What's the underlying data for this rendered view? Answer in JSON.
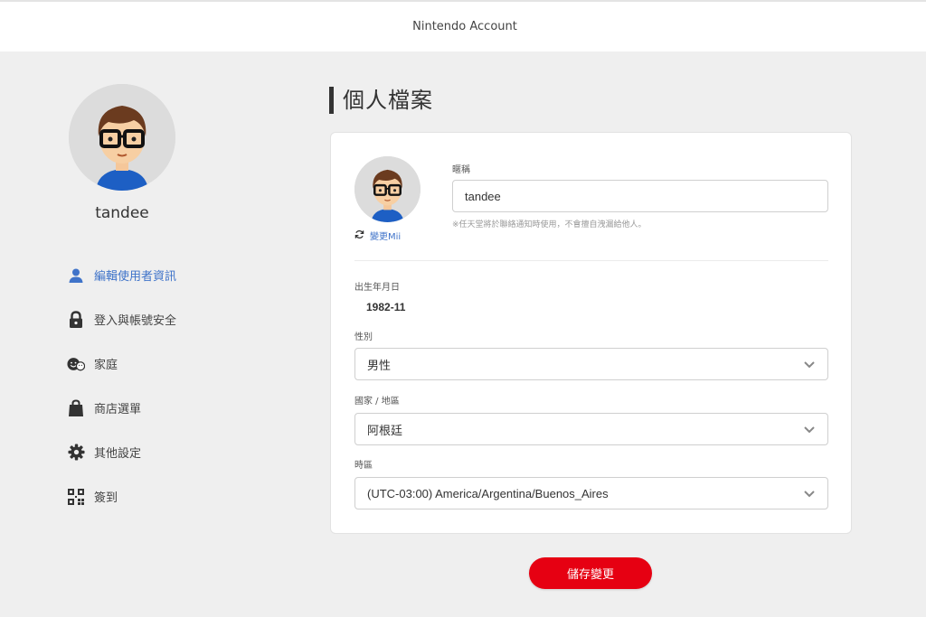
{
  "header": {
    "title": "Nintendo Account"
  },
  "sidebar": {
    "username": "tandee",
    "items": [
      {
        "label": "編輯使用者資訊",
        "icon": "user-icon",
        "active": true
      },
      {
        "label": "登入與帳號安全",
        "icon": "lock-icon",
        "active": false
      },
      {
        "label": "家庭",
        "icon": "family-icon",
        "active": false
      },
      {
        "label": "商店選單",
        "icon": "shopping-bag-icon",
        "active": false
      },
      {
        "label": "其他設定",
        "icon": "gear-icon",
        "active": false
      },
      {
        "label": "簽到",
        "icon": "qr-code-icon",
        "active": false
      }
    ]
  },
  "main": {
    "title": "個人檔案",
    "change_mii": "變更Mii",
    "nickname": {
      "label": "暱稱",
      "value": "tandee",
      "note": "※任天堂將於聯絡通知時使用，不會擅自洩漏給他人。"
    },
    "birth": {
      "label": "出生年月日",
      "value": "1982-11"
    },
    "gender": {
      "label": "性別",
      "value": "男性"
    },
    "country": {
      "label": "國家 / 地區",
      "value": "阿根廷"
    },
    "timezone": {
      "label": "時區",
      "value": "(UTC-03:00) America/Argentina/Buenos_Aires"
    },
    "save_label": "儲存變更"
  },
  "colors": {
    "accent": "#3f73c9",
    "save": "#e60012"
  }
}
